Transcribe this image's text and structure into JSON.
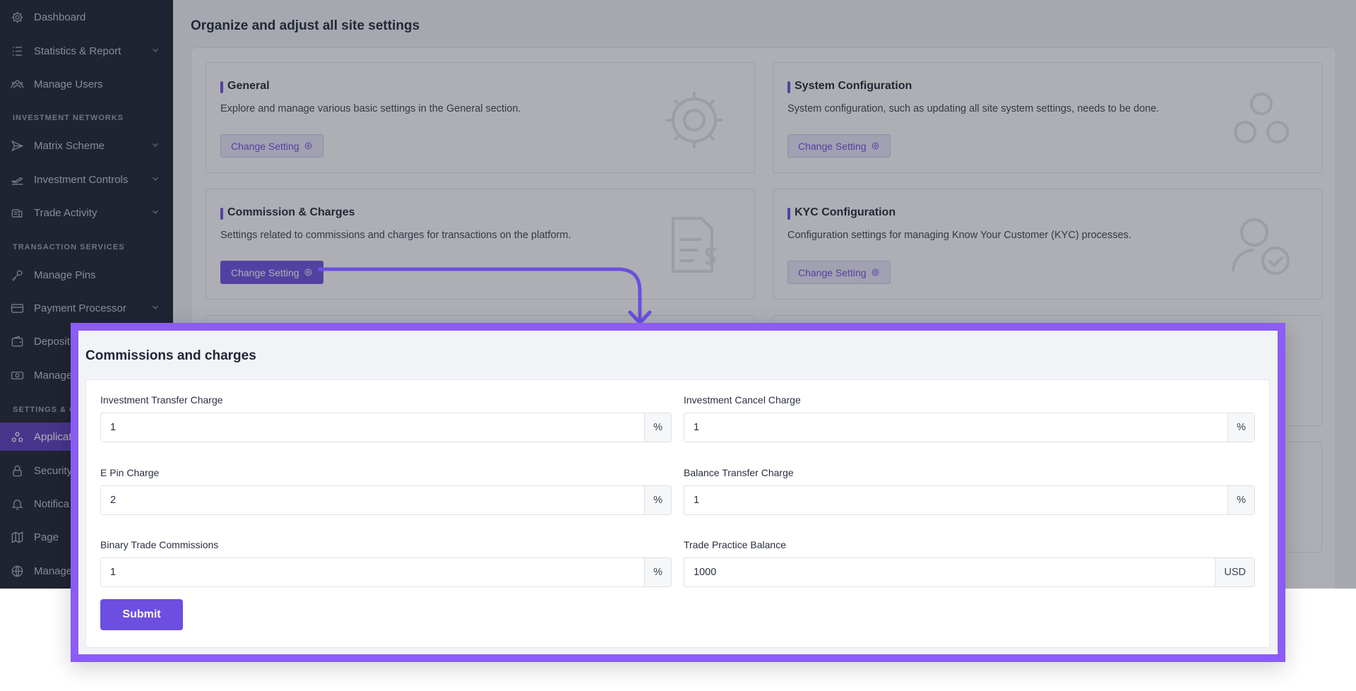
{
  "sidebar": {
    "items": [
      {
        "label": "Dashboard",
        "icon": "gear-icon"
      },
      {
        "label": "Statistics & Report",
        "icon": "list-icon"
      },
      {
        "label": "Manage Users",
        "icon": "users-icon"
      },
      {
        "label": "Matrix Scheme",
        "icon": "send-icon"
      },
      {
        "label": "Investment Controls",
        "icon": "plane-icon"
      },
      {
        "label": "Trade Activity",
        "icon": "coins-icon"
      },
      {
        "label": "Manage Pins",
        "icon": "key-icon"
      },
      {
        "label": "Payment Processor",
        "icon": "card-icon"
      },
      {
        "label": "Deposit",
        "icon": "wallet-icon"
      },
      {
        "label": "Manage",
        "icon": "cash-icon"
      },
      {
        "label": "Applicat",
        "icon": "apps-icon"
      },
      {
        "label": "Security",
        "icon": "lock-icon"
      },
      {
        "label": "Notifica",
        "icon": "bell-icon"
      },
      {
        "label": "Page",
        "icon": "map-icon"
      },
      {
        "label": "Manage",
        "icon": "globe-icon"
      }
    ],
    "sections": [
      "INVESTMENT NETWORKS",
      "TRANSACTION SERVICES",
      "SETTINGS & O"
    ]
  },
  "page": {
    "title": "Organize and adjust all site settings"
  },
  "cards": [
    {
      "title": "General",
      "desc": "Explore and manage various basic settings in the General section.",
      "button": "Change Setting",
      "icon": "gear-icon"
    },
    {
      "title": "System Configuration",
      "desc": "System configuration, such as updating all site system settings, needs to be done.",
      "button": "Change Setting",
      "icon": "gears-icon"
    },
    {
      "title": "Commission & Charges",
      "desc": "Settings related to commissions and charges for transactions on the platform.",
      "button": "Change Setting",
      "icon": "invoice-dollar-icon"
    },
    {
      "title": "KYC Configuration",
      "desc": "Configuration settings for managing Know Your Customer (KYC) processes.",
      "button": "Change Setting",
      "icon": "user-check-icon"
    }
  ],
  "modal": {
    "title": "Commissions and charges",
    "fields": [
      {
        "label": "Investment Transfer Charge",
        "value": "1",
        "addon": "%"
      },
      {
        "label": "Investment Cancel Charge",
        "value": "1",
        "addon": "%"
      },
      {
        "label": "E Pin Charge",
        "value": "2",
        "addon": "%"
      },
      {
        "label": "Balance Transfer Charge",
        "value": "1",
        "addon": "%"
      },
      {
        "label": "Binary Trade Commissions",
        "value": "1",
        "addon": "%"
      },
      {
        "label": "Trade Practice Balance",
        "value": "1000",
        "addon": "USD"
      }
    ],
    "submit": "Submit"
  },
  "colors": {
    "accent": "#6c4ee0",
    "modal_border": "#8b5cf6",
    "sidebar_bg": "#1b1f2e"
  }
}
